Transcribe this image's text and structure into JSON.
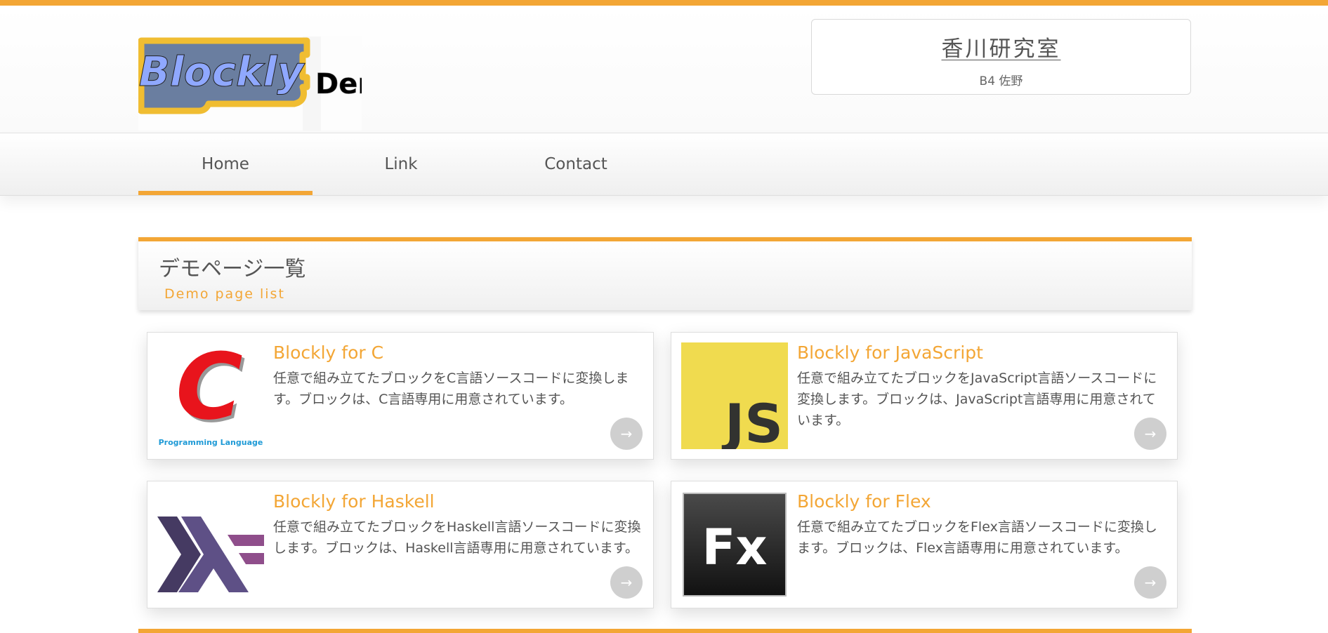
{
  "header": {
    "logo_text": "Blockly",
    "logo_demo": "Demo",
    "lab_title": "香川研究室",
    "lab_subtitle": "B4 佐野"
  },
  "nav": [
    {
      "label": "Home",
      "active": true
    },
    {
      "label": "Link",
      "active": false
    },
    {
      "label": "Contact",
      "active": false
    }
  ],
  "section": {
    "title": "デモページ一覧",
    "subtitle": "Demo page list"
  },
  "cards": [
    {
      "title": "Blockly for C",
      "description": "任意で組み立てたブロックをC言語ソースコードに変換します。ブロックは、C言語専用に用意されています。",
      "icon": "c-language-icon",
      "icon_caption": "Programming Language",
      "arrow": "→"
    },
    {
      "title": "Blockly for JavaScript",
      "description": "任意で組み立てたブロックをJavaScript言語ソースコードに変換します。ブロックは、JavaScript言語専用に用意されています。",
      "icon": "javascript-icon",
      "icon_text": "JS",
      "arrow": "→"
    },
    {
      "title": "Blockly for Haskell",
      "description": "任意で組み立てたブロックをHaskell言語ソースコードに変換します。ブロックは、Haskell言語専用に用意されています。",
      "icon": "haskell-icon",
      "arrow": "→"
    },
    {
      "title": "Blockly for Flex",
      "description": "任意で組み立てたブロックをFlex言語ソースコードに変換します。ブロックは、Flex言語専用に用意されています。",
      "icon": "flex-icon",
      "icon_text": "Fx",
      "arrow": "→"
    }
  ],
  "colors": {
    "accent": "#f3a635",
    "js_yellow": "#f0db4f",
    "c_red": "#e8141c",
    "caption_blue": "#1e9ad6",
    "haskell_dark": "#453a62",
    "haskell_mid": "#5e5086",
    "haskell_light": "#8f4e8b"
  }
}
